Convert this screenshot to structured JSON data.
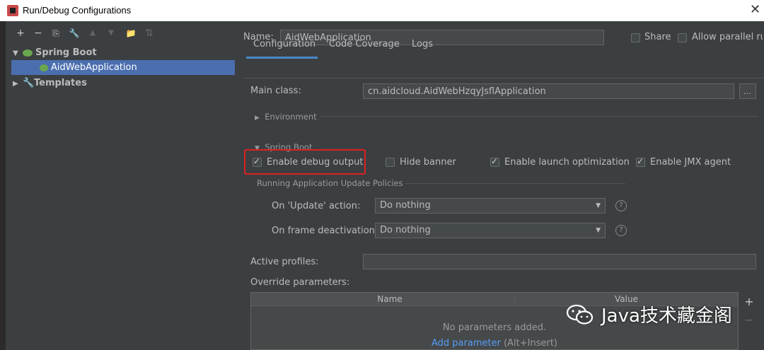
{
  "window": {
    "title": "Run/Debug Configurations",
    "close": "✕"
  },
  "toolbar": {
    "add": "+",
    "remove": "−",
    "copy": "⎘",
    "edit": "🔧",
    "up": "▲",
    "down": "▼",
    "folder": "📁",
    "sort": "⇅"
  },
  "tree": {
    "groups": [
      {
        "label": "Spring Boot",
        "expanded": "▼"
      },
      {
        "label": "Templates",
        "expanded": "▶"
      }
    ],
    "selected": "AidWebApplication"
  },
  "form": {
    "name_label": "Name:",
    "name_value": "AidWebApplication",
    "share_label": "Share",
    "parallel_label": "Allow parallel run"
  },
  "tabs": [
    {
      "label": "Configuration"
    },
    {
      "label": "Code Coverage"
    },
    {
      "label": "Logs"
    }
  ],
  "config": {
    "main_class_label": "Main class:",
    "main_class_value": "cn.aidcloud.AidWebHzqyJsflApplication",
    "browse": "...",
    "environment": "Environment",
    "spring_boot": "Spring Boot",
    "enable_debug": "Enable debug output",
    "hide_banner": "Hide banner",
    "launch_opt": "Enable launch optimization",
    "jmx": "Enable JMX agent",
    "policies_title": "Running Application Update Policies",
    "update_label": "On 'Update' action:",
    "update_value": "Do nothing",
    "frame_label": "On frame deactivation:",
    "frame_value": "Do nothing",
    "help": "?",
    "profiles_label": "Active profiles:",
    "override_label": "Override parameters:"
  },
  "table": {
    "columns": [
      "Name",
      "Value"
    ],
    "empty": "No parameters added.",
    "add_link": "Add parameter",
    "add_hint": "(Alt+Insert)",
    "side_add": "+",
    "side_remove": "−"
  },
  "checkboxes": {
    "share": false,
    "parallel": false,
    "debug": true,
    "banner": false,
    "launch": true,
    "jmx": true
  },
  "watermark": {
    "text": "Java技术藏金阁"
  },
  "colors": {
    "background": "#3c3f41",
    "selection": "#4b6eaf",
    "link": "#589df6",
    "highlight": "#e02020"
  }
}
